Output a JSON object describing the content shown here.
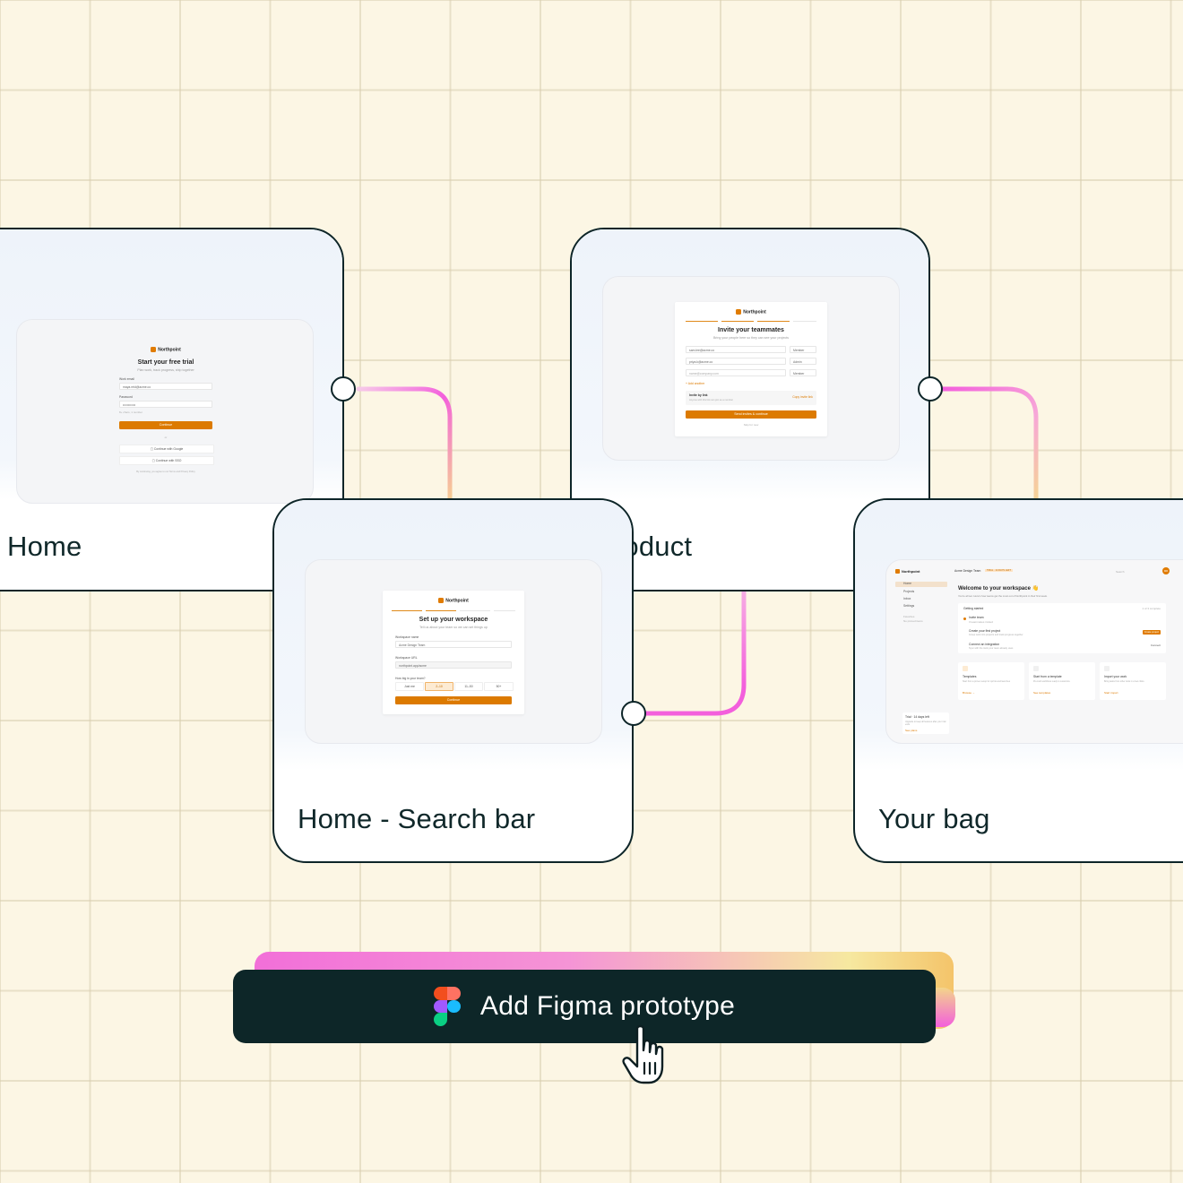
{
  "cards": {
    "home": {
      "label": "Home"
    },
    "product": {
      "label": "Product"
    },
    "search": {
      "label": "Home - Search bar"
    },
    "bag": {
      "label": "Your bag"
    }
  },
  "screens": {
    "trial": {
      "brand": "Northpoint",
      "title": "Start your free trial",
      "subtitle": "Plan work, track progress, ship together",
      "email_label": "Work email",
      "email_value": "maya.reid@acme.co",
      "password_label": "Password",
      "password_value": "••••••••••••",
      "hint": "8+ chars, 1 number",
      "continue": "Continue",
      "or": "or",
      "google": "Continue with Google",
      "sso": "Continue with SSO",
      "footer": "By continuing, you agree to our Terms and Privacy Policy"
    },
    "invite": {
      "brand": "Northpoint",
      "title": "Invite your teammates",
      "subtitle": "Bring your people here so they can see your projects",
      "rows": [
        {
          "email": "sam.lee@acme.co",
          "role": "Member"
        },
        {
          "email": "priya.k@acme.co",
          "role": "Admin"
        },
        {
          "email": "name@company.com",
          "role": "Member"
        }
      ],
      "add_another": "+ Add another",
      "invite_link_title": "Invite by link",
      "invite_link_sub": "Anyone with this link can join as a member",
      "copy_link": "Copy invite link",
      "send": "Send invites & continue",
      "skip": "Skip for now"
    },
    "workspace": {
      "brand": "Northpoint",
      "title": "Set up your workspace",
      "subtitle": "Tell us about your team so we can set things up",
      "name_label": "Workspace name",
      "name_value": "Acme Design Team",
      "url_label": "Workspace URL",
      "url_value": "northpoint.app/acme",
      "size_label": "How big is your team?",
      "sizes": [
        "Just me",
        "2–10",
        "11–50",
        "50+"
      ],
      "continue": "Continue"
    },
    "dashboard": {
      "brand": "Northpoint",
      "team": "Acme Design Team",
      "badge": "TRIAL · 14 DAYS LEFT",
      "search": "Search",
      "avatar": "MR",
      "nav": [
        "Home",
        "Projects",
        "Inbox",
        "Settings"
      ],
      "nav_section": "Favorites",
      "nav_sub": "No pinned items",
      "welcome": "Welcome to your workspace",
      "welcome_emoji": "👋",
      "welcome_sub": "You're all set. Here's how teams get the most out of Northpoint in their first week.",
      "getting_started": "Getting started",
      "progress": "1 of 3 complete",
      "tasks": [
        {
          "title": "Invite team",
          "sub": "3 teammates invited"
        },
        {
          "title": "Create your first project",
          "sub": "Group work into projects and track progress together",
          "action": "Create project"
        },
        {
          "title": "Connect an integration",
          "sub": "Sync with the tools your team already uses",
          "action": "Connect"
        }
      ],
      "tiles": [
        {
          "title": "Templates",
          "sub": "Start from a proven setup for sprints and launches",
          "link": "Browse →"
        },
        {
          "title": "Start from a template",
          "sub": "Pre-built workflows ready to customize",
          "link": "See templates"
        },
        {
          "title": "Import your work",
          "sub": "Bring tasks from other tools in a few clicks",
          "link": "Start import"
        }
      ],
      "trial_title": "Trial · 14 days left",
      "trial_sub": "Upgrade to keep all features after your trial ends",
      "trial_link": "See plans"
    }
  },
  "cta": {
    "label": "Add Figma prototype"
  },
  "icons": {
    "figma": "figma-logo-icon",
    "cursor": "hand-pointer-icon"
  },
  "colors": {
    "background": "#fcf6e4",
    "card_border": "#0d2528",
    "cta_bg": "#0d2628",
    "accent": "#dc7a00",
    "connector_pink": "#f35fdc",
    "connector_yellow": "#f6d98c"
  }
}
